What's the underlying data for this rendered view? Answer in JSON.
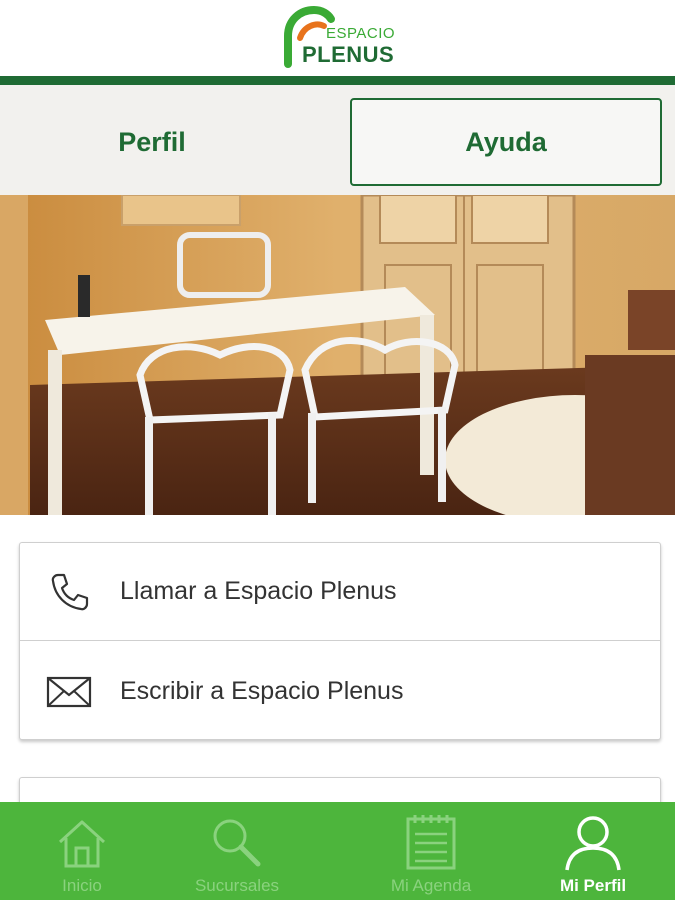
{
  "header": {
    "logo_top": "ESPACIO",
    "logo_main": "PLENUS"
  },
  "tabs": [
    {
      "label": "Perfil",
      "active": false
    },
    {
      "label": "Ayuda",
      "active": true
    }
  ],
  "contact": {
    "call_label": "Llamar a Espacio Plenus",
    "write_label": "Escribir a Espacio Plenus"
  },
  "bottom_nav": {
    "items": [
      {
        "label": "Inicio",
        "icon": "home-icon",
        "active": false
      },
      {
        "label": "Sucursales",
        "icon": "search-icon",
        "active": false
      },
      {
        "label": "Mi Agenda",
        "icon": "agenda-icon",
        "active": false
      },
      {
        "label": "Mi Perfil",
        "icon": "profile-icon",
        "active": true
      }
    ]
  },
  "colors": {
    "brand_green": "#1f6b34",
    "logo_green": "#3aaa35",
    "logo_orange": "#e8731c",
    "nav_background": "#4db53c",
    "nav_inactive": "#8ad27e",
    "nav_active": "#ffffff",
    "icon_color": "#333333"
  }
}
